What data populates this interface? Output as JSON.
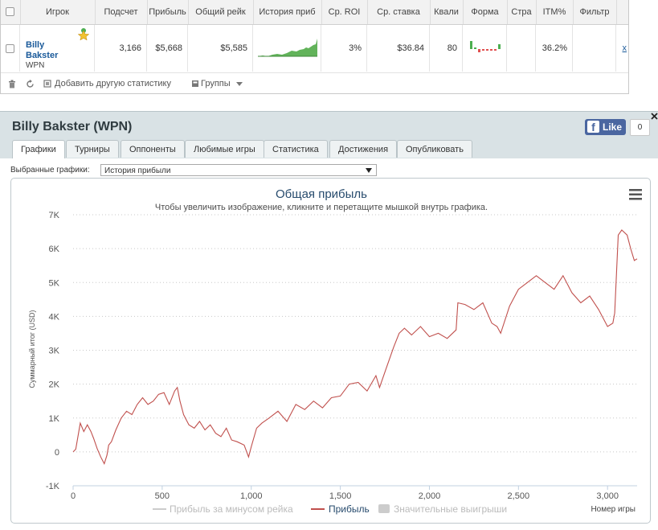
{
  "stats_table": {
    "columns": [
      "Игрок",
      "Подсчет",
      "Прибыль",
      "Общий рейк",
      "История приб",
      "Ср. ROI",
      "Ср. ставка",
      "Квали",
      "Форма",
      "Стра",
      "ITM%",
      "Фильтр"
    ],
    "row": {
      "player_first": "Billy",
      "player_last": "Bakster",
      "site": "WPN",
      "count": "3,166",
      "profit": "$5,668",
      "rake": "$5,585",
      "roi": "3%",
      "avg_stake": "$36.84",
      "quali": "80",
      "itm": "36.2%",
      "remove_link": "x"
    },
    "footer": {
      "add_stat": "Добавить другую статистику",
      "groups": "Группы"
    }
  },
  "panel": {
    "title": "Billy Bakster (WPN)",
    "tabs": [
      "Графики",
      "Турниры",
      "Оппоненты",
      "Любимые игры",
      "Статистика",
      "Достижения",
      "Опубликовать"
    ],
    "fb_like": "Like",
    "fb_count": "0",
    "selected_label": "Выбранные графики:",
    "selected_value": "История прибыли"
  },
  "colors": {
    "profit_line": "#c0504d",
    "accent": "#1a5a9a",
    "panel_bg": "#d9e2e5"
  },
  "chart_data": {
    "type": "line",
    "title": "Общая прибыль",
    "subtitle": "Чтобы увеличить изображение, кликните и перетащите мышкой внутрь графика.",
    "xlabel": "Номер игры",
    "ylabel": "Суммарный итог (USD)",
    "xlim": [
      0,
      3166
    ],
    "ylim": [
      -1000,
      7000
    ],
    "xticks": [
      "0",
      "500",
      "1,000",
      "1,500",
      "2,000",
      "2,500",
      "3,000"
    ],
    "xtick_values": [
      0,
      500,
      1000,
      1500,
      2000,
      2500,
      3000
    ],
    "yticks": [
      "-1K",
      "0",
      "1K",
      "2K",
      "3K",
      "4K",
      "5K",
      "6K",
      "7K"
    ],
    "ytick_values": [
      -1000,
      0,
      1000,
      2000,
      3000,
      4000,
      5000,
      6000,
      7000
    ],
    "grid": true,
    "legend_position": "bottom",
    "legend": [
      "Прибыль за минусом рейка",
      "Прибыль",
      "Значительные выигрыши"
    ],
    "series": [
      {
        "name": "Прибыль",
        "x": [
          0,
          15,
          40,
          60,
          80,
          100,
          115,
          135,
          155,
          175,
          190,
          200,
          215,
          240,
          270,
          300,
          330,
          360,
          390,
          420,
          450,
          480,
          510,
          540,
          570,
          585,
          600,
          620,
          650,
          680,
          710,
          740,
          770,
          800,
          830,
          860,
          890,
          920,
          960,
          985,
          1000,
          1030,
          1060,
          1100,
          1150,
          1200,
          1250,
          1300,
          1350,
          1400,
          1450,
          1500,
          1550,
          1600,
          1650,
          1700,
          1720,
          1760,
          1800,
          1830,
          1860,
          1900,
          1950,
          2000,
          2050,
          2100,
          2150,
          2160,
          2200,
          2250,
          2300,
          2350,
          2380,
          2400,
          2450,
          2500,
          2550,
          2600,
          2650,
          2700,
          2750,
          2800,
          2850,
          2900,
          2950,
          3000,
          3030,
          3040,
          3060,
          3080,
          3110,
          3130,
          3150,
          3166
        ],
        "y": [
          0,
          80,
          850,
          600,
          800,
          600,
          400,
          100,
          -150,
          -350,
          -100,
          200,
          300,
          650,
          1000,
          1200,
          1100,
          1400,
          1600,
          1400,
          1500,
          1700,
          1750,
          1400,
          1800,
          1900,
          1500,
          1100,
          800,
          700,
          900,
          650,
          800,
          550,
          450,
          700,
          350,
          300,
          200,
          -150,
          150,
          700,
          850,
          1000,
          1200,
          900,
          1400,
          1250,
          1500,
          1300,
          1600,
          1650,
          2000,
          2050,
          1800,
          2250,
          1900,
          2500,
          3100,
          3500,
          3650,
          3450,
          3700,
          3400,
          3500,
          3350,
          3600,
          4400,
          4350,
          4200,
          4400,
          3800,
          3700,
          3500,
          4300,
          4800,
          5000,
          5200,
          5000,
          4800,
          5200,
          4700,
          4400,
          4600,
          4200,
          3700,
          3800,
          4100,
          6400,
          6550,
          6400,
          6000,
          5650,
          5700
        ]
      }
    ]
  }
}
